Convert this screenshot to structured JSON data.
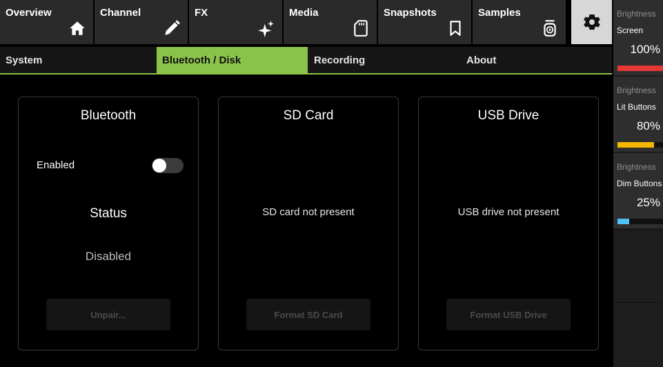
{
  "nav": {
    "tabs": [
      {
        "label": "Overview",
        "icon": "home-icon"
      },
      {
        "label": "Channel",
        "icon": "pencil-icon"
      },
      {
        "label": "FX",
        "icon": "sparkles-icon"
      },
      {
        "label": "Media",
        "icon": "sd-card-icon"
      },
      {
        "label": "Snapshots",
        "icon": "bookmark-icon"
      },
      {
        "label": "Samples",
        "icon": "sample-player-icon"
      }
    ],
    "settings_icon": "gear-icon"
  },
  "subtabs": [
    {
      "label": "System"
    },
    {
      "label": "Bluetooth / Disk",
      "active": true
    },
    {
      "label": "Recording"
    },
    {
      "label": "About"
    }
  ],
  "bluetooth": {
    "title": "Bluetooth",
    "enabled_label": "Enabled",
    "enabled": false,
    "status_label": "Status",
    "status_value": "Disabled",
    "button": "Unpair..."
  },
  "sd_card": {
    "title": "SD Card",
    "message": "SD card not present",
    "button": "Format SD Card"
  },
  "usb": {
    "title": "USB Drive",
    "message": "USB drive not present",
    "button": "Format USB Drive"
  },
  "brightness": [
    {
      "heading": "Brightness",
      "name": "Screen",
      "value": "100%",
      "level": 1.0,
      "color": "#e53935"
    },
    {
      "heading": "Brightness",
      "name": "Lit Buttons",
      "value": "80%",
      "level": 0.8,
      "color": "#f5b800"
    },
    {
      "heading": "Brightness",
      "name": "Dim Buttons",
      "value": "25%",
      "level": 0.25,
      "color": "#4fc3f7"
    }
  ],
  "colors": {
    "accent": "#8bc34a"
  }
}
